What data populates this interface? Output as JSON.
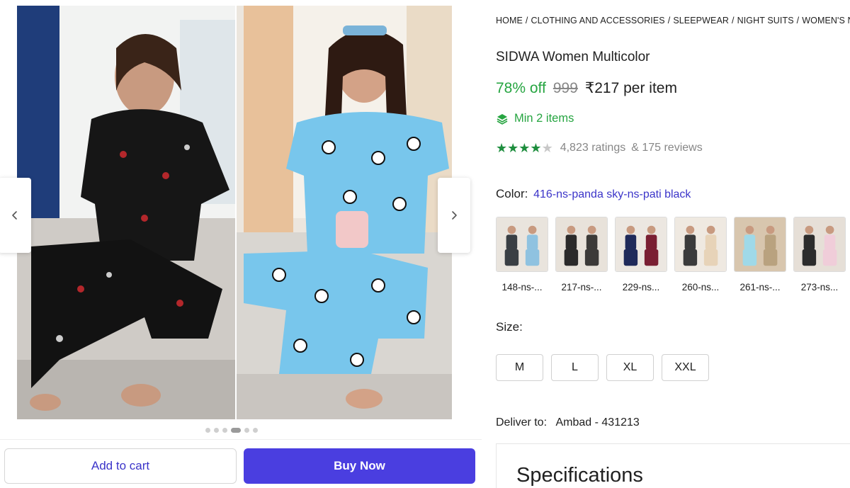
{
  "gallery": {
    "prev_label": "previous image",
    "next_label": "next image",
    "dots_count": 6,
    "active_dot": 3
  },
  "actions": {
    "add_to_cart": "Add to cart",
    "buy_now": "Buy Now"
  },
  "breadcrumb": [
    "HOME",
    "CLOTHING AND ACCESSORIES",
    "SLEEPWEAR",
    "NIGHT SUITS",
    "WOMEN'S NIGHT"
  ],
  "product": {
    "title": "SIDWA Women Multicolor",
    "discount": "78% off",
    "mrp": "999",
    "price": "₹217 per item",
    "min_items": "Min 2 items",
    "rating": 4.5,
    "ratings_count": "4,823 ratings",
    "reviews_count": "& 175 reviews"
  },
  "color": {
    "label": "Color:",
    "value": "416-ns-panda sky-ns-pati black",
    "options": [
      {
        "caption": "148-ns-...",
        "a": "#3a3f44",
        "b": "#8fc2e0",
        "bg": "#e9e4dd"
      },
      {
        "caption": "217-ns-...",
        "a": "#2b2a2a",
        "b": "#3c3a38",
        "bg": "#e8e2da"
      },
      {
        "caption": "229-ns...",
        "a": "#1f2a5a",
        "b": "#7a1f33",
        "bg": "#ece7e1"
      },
      {
        "caption": "260-ns...",
        "a": "#3b3b3b",
        "b": "#e7d3b8",
        "bg": "#efe9e1"
      },
      {
        "caption": "261-ns-...",
        "a": "#9fd9e8",
        "b": "#b9a27f",
        "bg": "#d8c6ae"
      },
      {
        "caption": "273-ns...",
        "a": "#2c2c2c",
        "b": "#f0cdd9",
        "bg": "#e6dfd7"
      }
    ]
  },
  "size": {
    "label": "Size:",
    "options": [
      "M",
      "L",
      "XL",
      "XXL"
    ]
  },
  "delivery": {
    "label": "Deliver to:",
    "location": "Ambad - 431213"
  },
  "specifications": {
    "title": "Specifications"
  },
  "colors": {
    "accent": "#4a3ee0",
    "link": "#3b34c9",
    "green": "#26a541"
  }
}
